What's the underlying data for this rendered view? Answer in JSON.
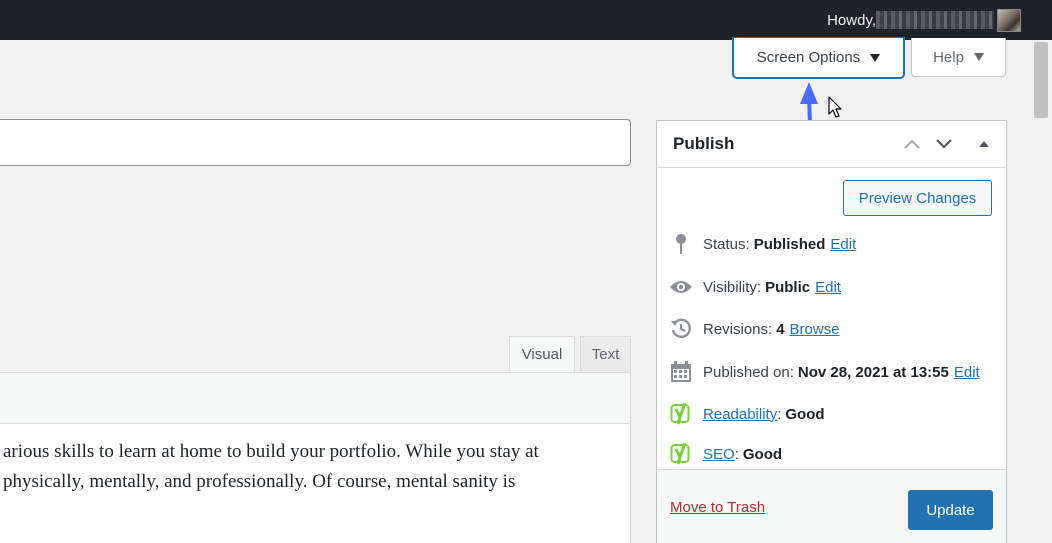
{
  "adminbar": {
    "greeting": "Howdy, "
  },
  "top_buttons": {
    "screen_options": "Screen Options",
    "help": "Help"
  },
  "editor": {
    "tabs": {
      "visual": "Visual",
      "text": "Text"
    },
    "content_lines": [
      "arious skills to learn at home to build your portfolio. While you stay at",
      "physically, mentally, and professionally. Of course, mental sanity is"
    ]
  },
  "publish": {
    "title": "Publish",
    "preview_button": "Preview Changes",
    "status": {
      "label": "Status:",
      "value": "Published",
      "action": "Edit"
    },
    "visibility": {
      "label": "Visibility:",
      "value": "Public",
      "action": "Edit"
    },
    "revisions": {
      "label": "Revisions:",
      "value": "4",
      "action": "Browse"
    },
    "published_on": {
      "label": "Published on:",
      "value": "Nov 28, 2021 at 13:55",
      "action": "Edit"
    },
    "readability": {
      "link": "Readability",
      "value": "Good"
    },
    "seo": {
      "link": "SEO",
      "value": "Good"
    },
    "trash": "Move to Trash",
    "update": "Update"
  },
  "colors": {
    "accent": "#2271b1",
    "arrow": "#4a6cf7",
    "yoast_green": "#7ad03a",
    "trash_red": "#b32d2e"
  }
}
